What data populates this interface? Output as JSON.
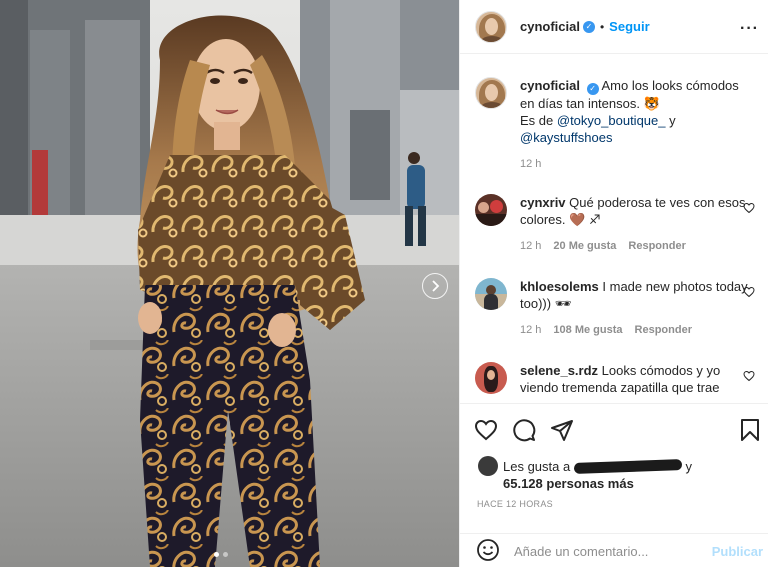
{
  "header": {
    "username": "cynoficial",
    "verified": true,
    "separator": "•",
    "follow_label": "Seguir",
    "more_icon": "ellipsis-icon"
  },
  "caption": {
    "username": "cynoficial",
    "text_1": "Amo los looks cómodos en días tan intensos.",
    "emoji": "🐯",
    "text_2": "Es de",
    "mention_1": "@tokyo_boutique_",
    "connector": "y",
    "mention_2": "@kaystuffshoes",
    "time": "12 h"
  },
  "comments": [
    {
      "username": "cynxriv",
      "text": "Qué poderosa te ves con esos colores.",
      "emoji": "🤎 ♐",
      "time": "12 h",
      "likes": "20 Me gusta",
      "reply": "Responder"
    },
    {
      "username": "khloesolems",
      "text": "I made new photos today too)))",
      "emoji": "🕶",
      "time": "12 h",
      "likes": "108 Me gusta",
      "reply": "Responder"
    },
    {
      "username": "selene_s.rdz",
      "text": "Looks cómodos y yo viendo tremenda zapatilla que trae",
      "emoji": "",
      "time": "",
      "likes": "",
      "reply": ""
    }
  ],
  "likes": {
    "prefix": "Les gusta a",
    "suffix": "y",
    "count": "65.128 personas más"
  },
  "timestamp": "HACE 12 HORAS",
  "composer": {
    "placeholder": "Añade un comentario...",
    "publish_label": "Publicar"
  },
  "colors": {
    "accent": "#0095f6",
    "publish_disabled": "#b2dffc",
    "muted": "#8e8e8e",
    "text": "#262626"
  }
}
